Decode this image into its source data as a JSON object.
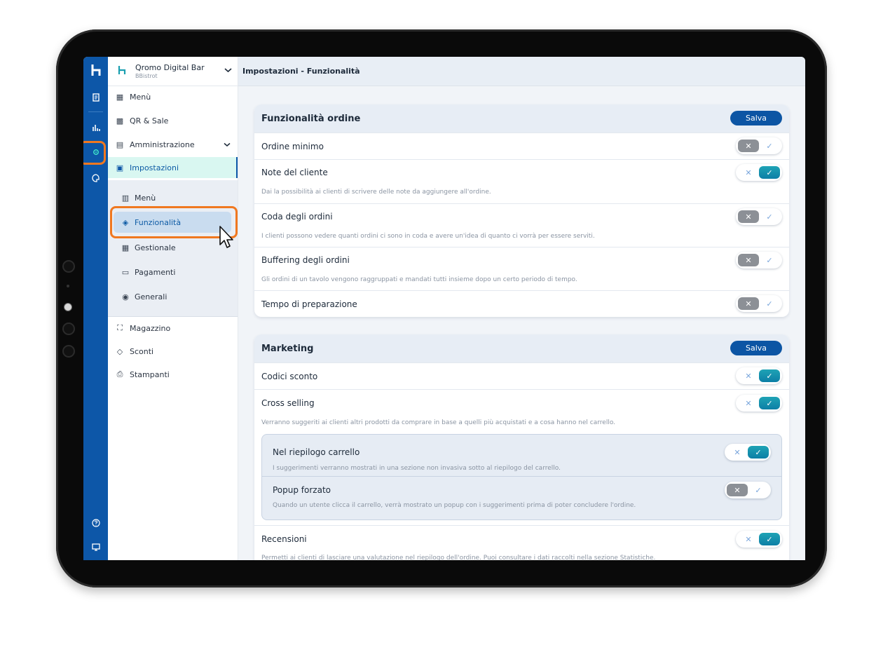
{
  "app": {
    "brand_name": "Qromo Digital Bar",
    "brand_sub": "BBistrot",
    "page_title": "Impostazioni - Funzionalità"
  },
  "rail": {
    "logo": "ꞁ",
    "icons": [
      "receipt-icon",
      "chart-icon",
      "settings-icon",
      "palette-icon",
      "help-icon",
      "monitor-icon"
    ]
  },
  "sidebar": {
    "items": [
      {
        "label": "Menù",
        "icon": "menu-icon"
      },
      {
        "label": "QR & Sale",
        "icon": "qr-icon"
      },
      {
        "label": "Amministrazione",
        "icon": "admin-icon"
      },
      {
        "label": "Impostazioni",
        "icon": "settings-icon"
      }
    ],
    "sub_items": [
      {
        "label": "Menù",
        "icon": "menu-icon"
      },
      {
        "label": "Funzionalità",
        "icon": "features-icon"
      },
      {
        "label": "Gestionale",
        "icon": "management-icon"
      },
      {
        "label": "Pagamenti",
        "icon": "payments-icon"
      },
      {
        "label": "Generali",
        "icon": "general-icon"
      }
    ],
    "bottom_items": [
      {
        "label": "Magazzino",
        "icon": "warehouse-icon"
      },
      {
        "label": "Sconti",
        "icon": "discount-icon"
      },
      {
        "label": "Stampanti",
        "icon": "printer-icon"
      }
    ]
  },
  "order_card": {
    "title": "Funzionalità ordine",
    "save_label": "Salva",
    "rows": [
      {
        "title": "Ordine minimo",
        "desc": "",
        "on": false
      },
      {
        "title": "Note del cliente",
        "desc": "Dai la possibilità ai clienti di scrivere delle note da aggiungere all'ordine.",
        "on": true
      },
      {
        "title": "Coda degli ordini",
        "desc": "I clienti possono vedere quanti ordini ci sono in coda e avere un'idea di quanto ci vorrà per essere serviti.",
        "on": false
      },
      {
        "title": "Buffering degli ordini",
        "desc": "Gli ordini di un tavolo vengono raggruppati e mandati tutti insieme dopo un certo periodo di tempo.",
        "on": false
      },
      {
        "title": "Tempo di preparazione",
        "desc": "",
        "on": false
      }
    ]
  },
  "marketing_card": {
    "title": "Marketing",
    "save_label": "Salva",
    "rows": [
      {
        "title": "Codici sconto",
        "desc": "",
        "on": true
      },
      {
        "title": "Cross selling",
        "desc": "Verranno suggeriti ai clienti altri prodotti da comprare in base a quelli più acquistati e a cosa hanno nel carrello.",
        "on": true
      }
    ],
    "sub_rows": [
      {
        "title": "Nel riepilogo carrello",
        "desc": "I suggerimenti verranno mostrati in una sezione non invasiva sotto al riepilogo del carrello.",
        "on": true
      },
      {
        "title": "Popup forzato",
        "desc": "Quando un utente clicca il carrello, verrà mostrato un popup con i suggerimenti prima di poter concludere l'ordine.",
        "on": false
      }
    ],
    "last_row": {
      "title": "Recensioni",
      "desc": "Permetti ai clienti di lasciare una valutazione nel riepilogo dell'ordine. Puoi consultare i dati raccolti nella sezione Statistiche.",
      "on": true
    }
  },
  "toggle_glyphs": {
    "off": "✕",
    "on": "✓"
  },
  "colors": {
    "primary": "#0d57a8",
    "accent": "#1fa3b5",
    "highlight": "#f07820",
    "active_bg": "#d9f7f1"
  }
}
